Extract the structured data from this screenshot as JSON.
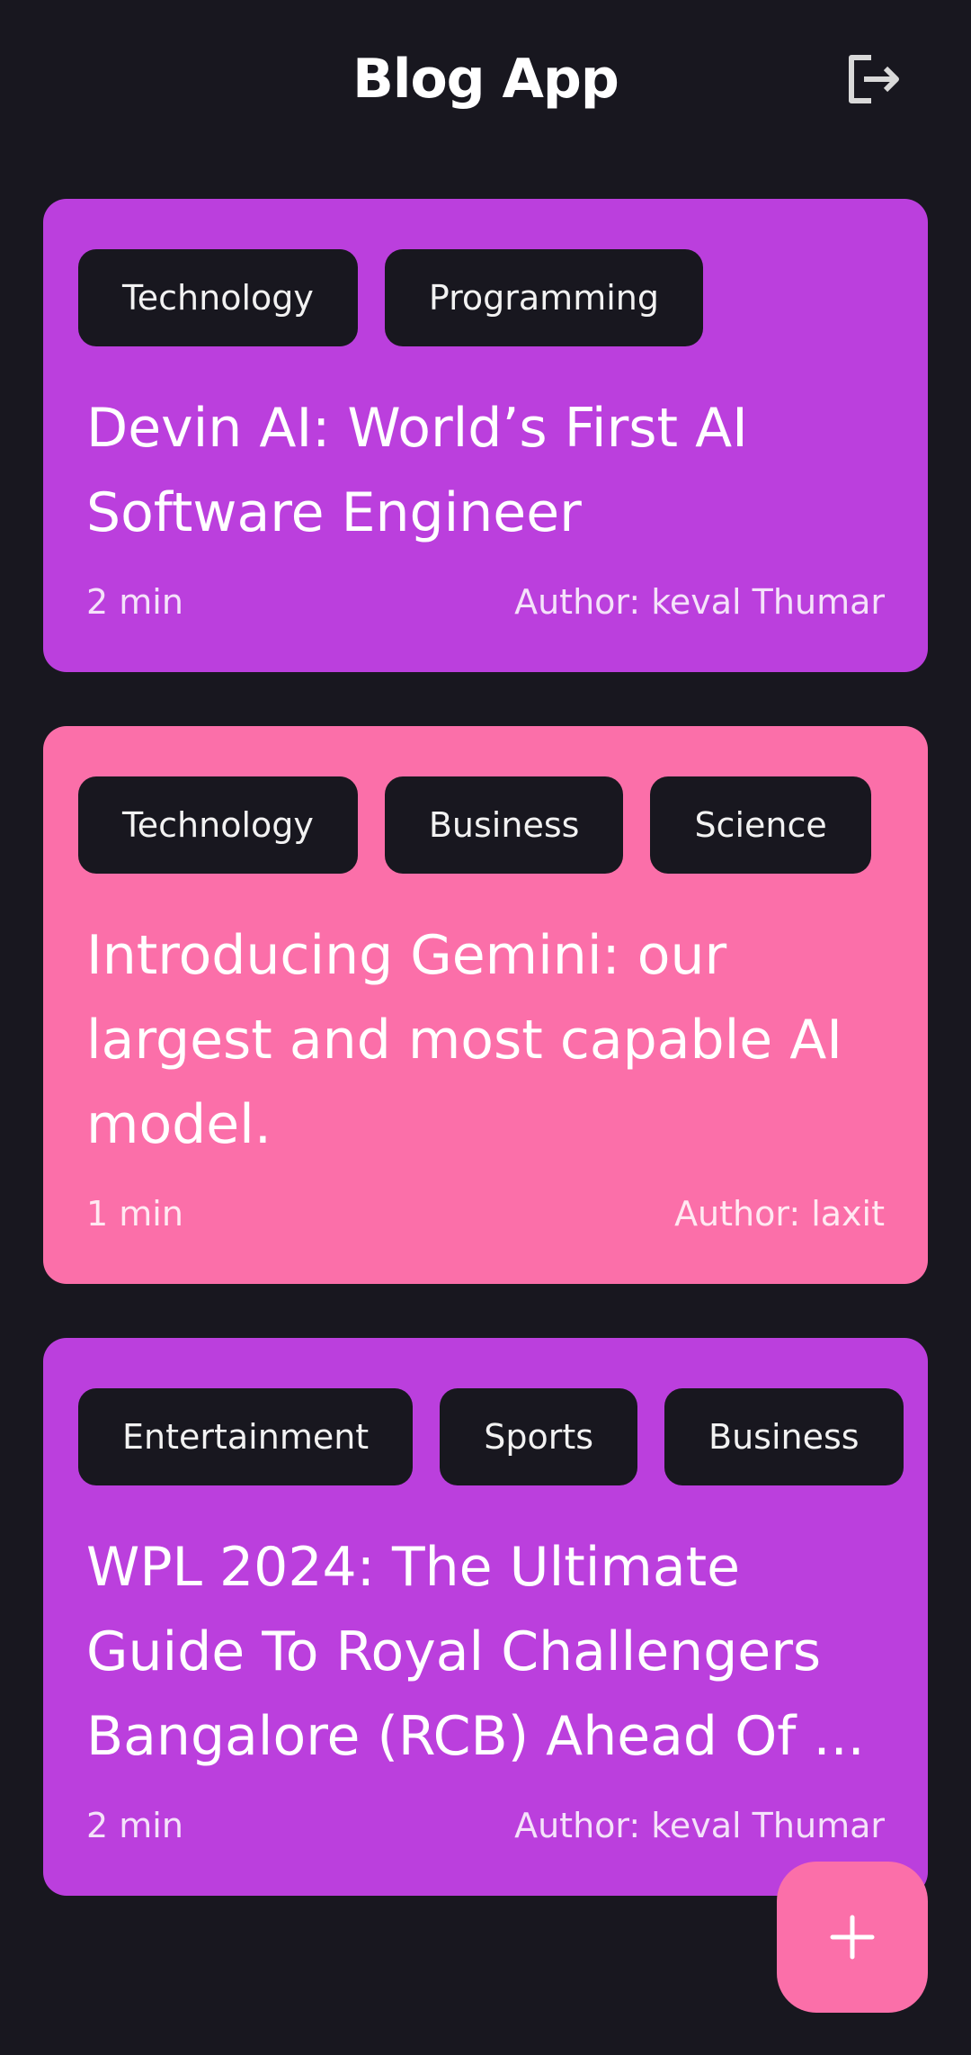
{
  "appbar": {
    "title": "Blog App",
    "logout_icon": "logout-icon"
  },
  "colors": {
    "background": "#18171f",
    "purple_card": "#bb3fdd",
    "pink_card": "#fb6fa9",
    "chip": "#18171f",
    "fab": "#fb6fa9"
  },
  "posts": [
    {
      "color": "#bb3fdd",
      "topics": [
        "Technology",
        "Programming"
      ],
      "title": "Devin AI: World’s First AI Software Engineer",
      "read_time": "2 min",
      "author": "Author: keval Thumar"
    },
    {
      "color": "#fb6fa9",
      "topics": [
        "Technology",
        "Business",
        "Science"
      ],
      "title": "Introducing Gemini: our largest and most capable AI model.",
      "read_time": "1 min",
      "author": "Author: laxit"
    },
    {
      "color": "#bb3fdd",
      "topics": [
        "Entertainment",
        "Sports",
        "Business"
      ],
      "title": "WPL 2024: The Ultimate Guide To Royal Challengers Bangalore (RCB) Ahead Of ...",
      "read_time": "2 min",
      "author": "Author: keval Thumar"
    }
  ],
  "fab": {
    "icon": "plus-icon"
  }
}
